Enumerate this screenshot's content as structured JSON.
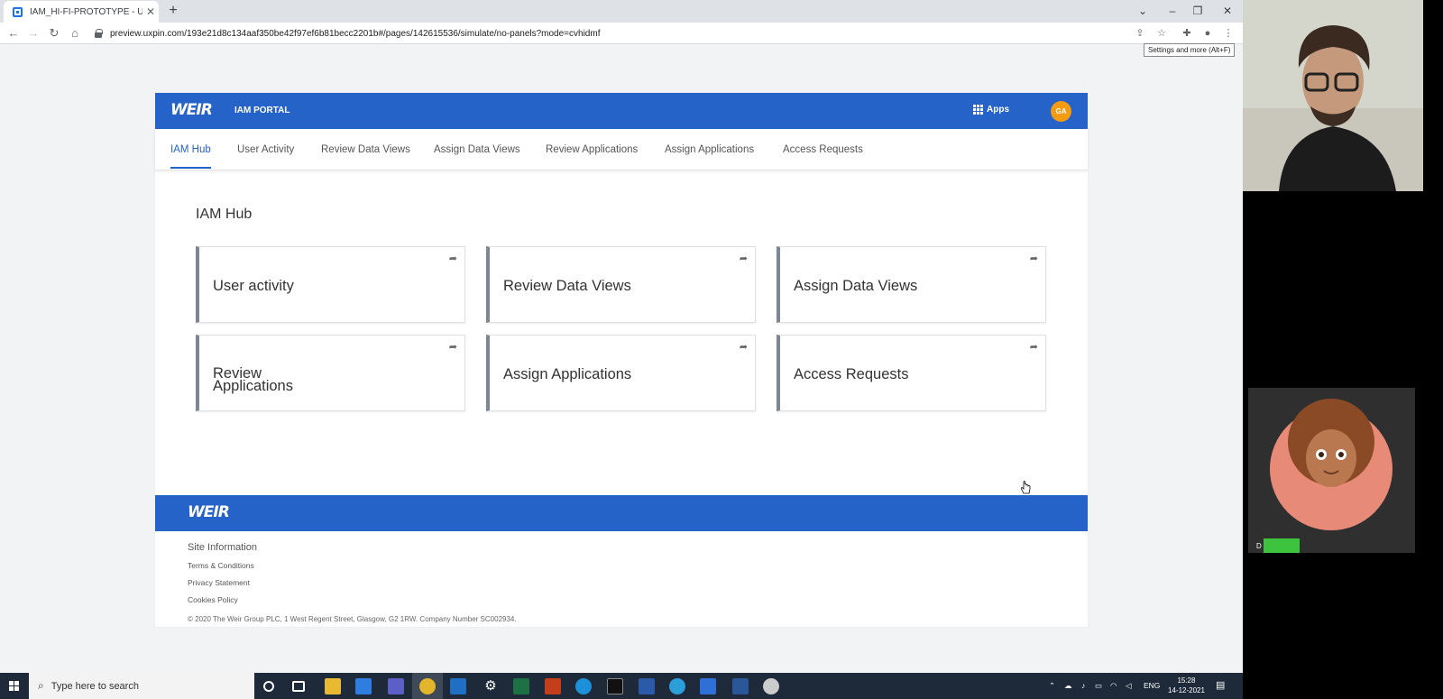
{
  "browser": {
    "tab_title": "IAM_HI-FI-PROTOTYPE - UXPin P",
    "tab_close": "✕",
    "new_tab": "+",
    "url": "preview.uxpin.com/193e21d8c134aaf350be42f97ef6b81becc2201b#/pages/142615536/simulate/no-panels?mode=cvhidmf",
    "tooltip": "Settings and more (Alt+F)",
    "window_controls": [
      "⌄",
      "–",
      "❐",
      "✕"
    ]
  },
  "app": {
    "logo": "WEIR",
    "portal_title": "IAM PORTAL",
    "apps_label": "Apps",
    "avatar_initials": "GA",
    "brand_color": "#2563c9"
  },
  "nav": {
    "items": [
      {
        "label": "IAM Hub",
        "active": true
      },
      {
        "label": "User Activity"
      },
      {
        "label": "Review Data Views"
      },
      {
        "label": "Assign Data Views"
      },
      {
        "label": "Review Applications"
      },
      {
        "label": "Assign Applications"
      },
      {
        "label": "Access Requests"
      }
    ]
  },
  "hub": {
    "title": "IAM Hub",
    "cards": [
      {
        "label": "User activity"
      },
      {
        "label": "Review Data Views"
      },
      {
        "label": "Assign Data Views"
      },
      {
        "label": "Review Applications"
      },
      {
        "label": "Assign Applications"
      },
      {
        "label": "Access Requests"
      }
    ]
  },
  "footer": {
    "logo": "WEIR",
    "site_info": "Site Information",
    "links": [
      "Terms & Conditions",
      "Privacy Statement",
      "Cookies Policy"
    ],
    "copyright": "© 2020 The Weir Group PLC, 1 West Regent Street, Glasgow, G2 1RW. Company Number SC002934."
  },
  "taskbar": {
    "search_placeholder": "Type here to search",
    "language": "ENG",
    "time": "15:28",
    "date": "14-12-2021"
  },
  "video": {
    "participant_initial": "D"
  }
}
